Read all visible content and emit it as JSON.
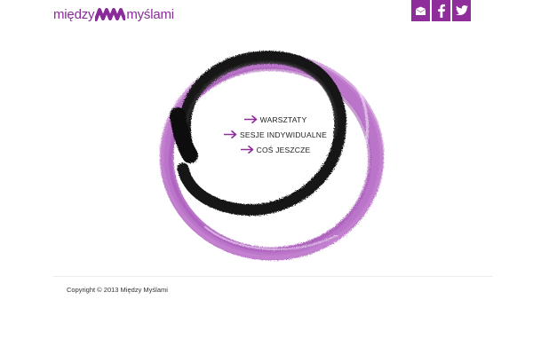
{
  "header": {
    "logo": {
      "part1": "między",
      "part2": "myślami"
    },
    "social": [
      {
        "icon": "mail-icon",
        "name": "social-mail-button"
      },
      {
        "icon": "facebook-icon",
        "name": "social-facebook-button"
      },
      {
        "icon": "twitter-icon",
        "name": "social-twitter-button"
      }
    ]
  },
  "menu": {
    "items": [
      {
        "label": "WARSZTATY"
      },
      {
        "label": "SESJE INDYWIDUALNE"
      },
      {
        "label": "COŚ JESZCZE"
      }
    ],
    "arrow_icon": "arrow-right-icon"
  },
  "footer": {
    "copyright": "Copyright © 2013 Między Myślami"
  },
  "colors": {
    "brand": "#8f2d9b",
    "brush_purple": "#b46bc3",
    "brush_black": "#1a1a1a"
  }
}
